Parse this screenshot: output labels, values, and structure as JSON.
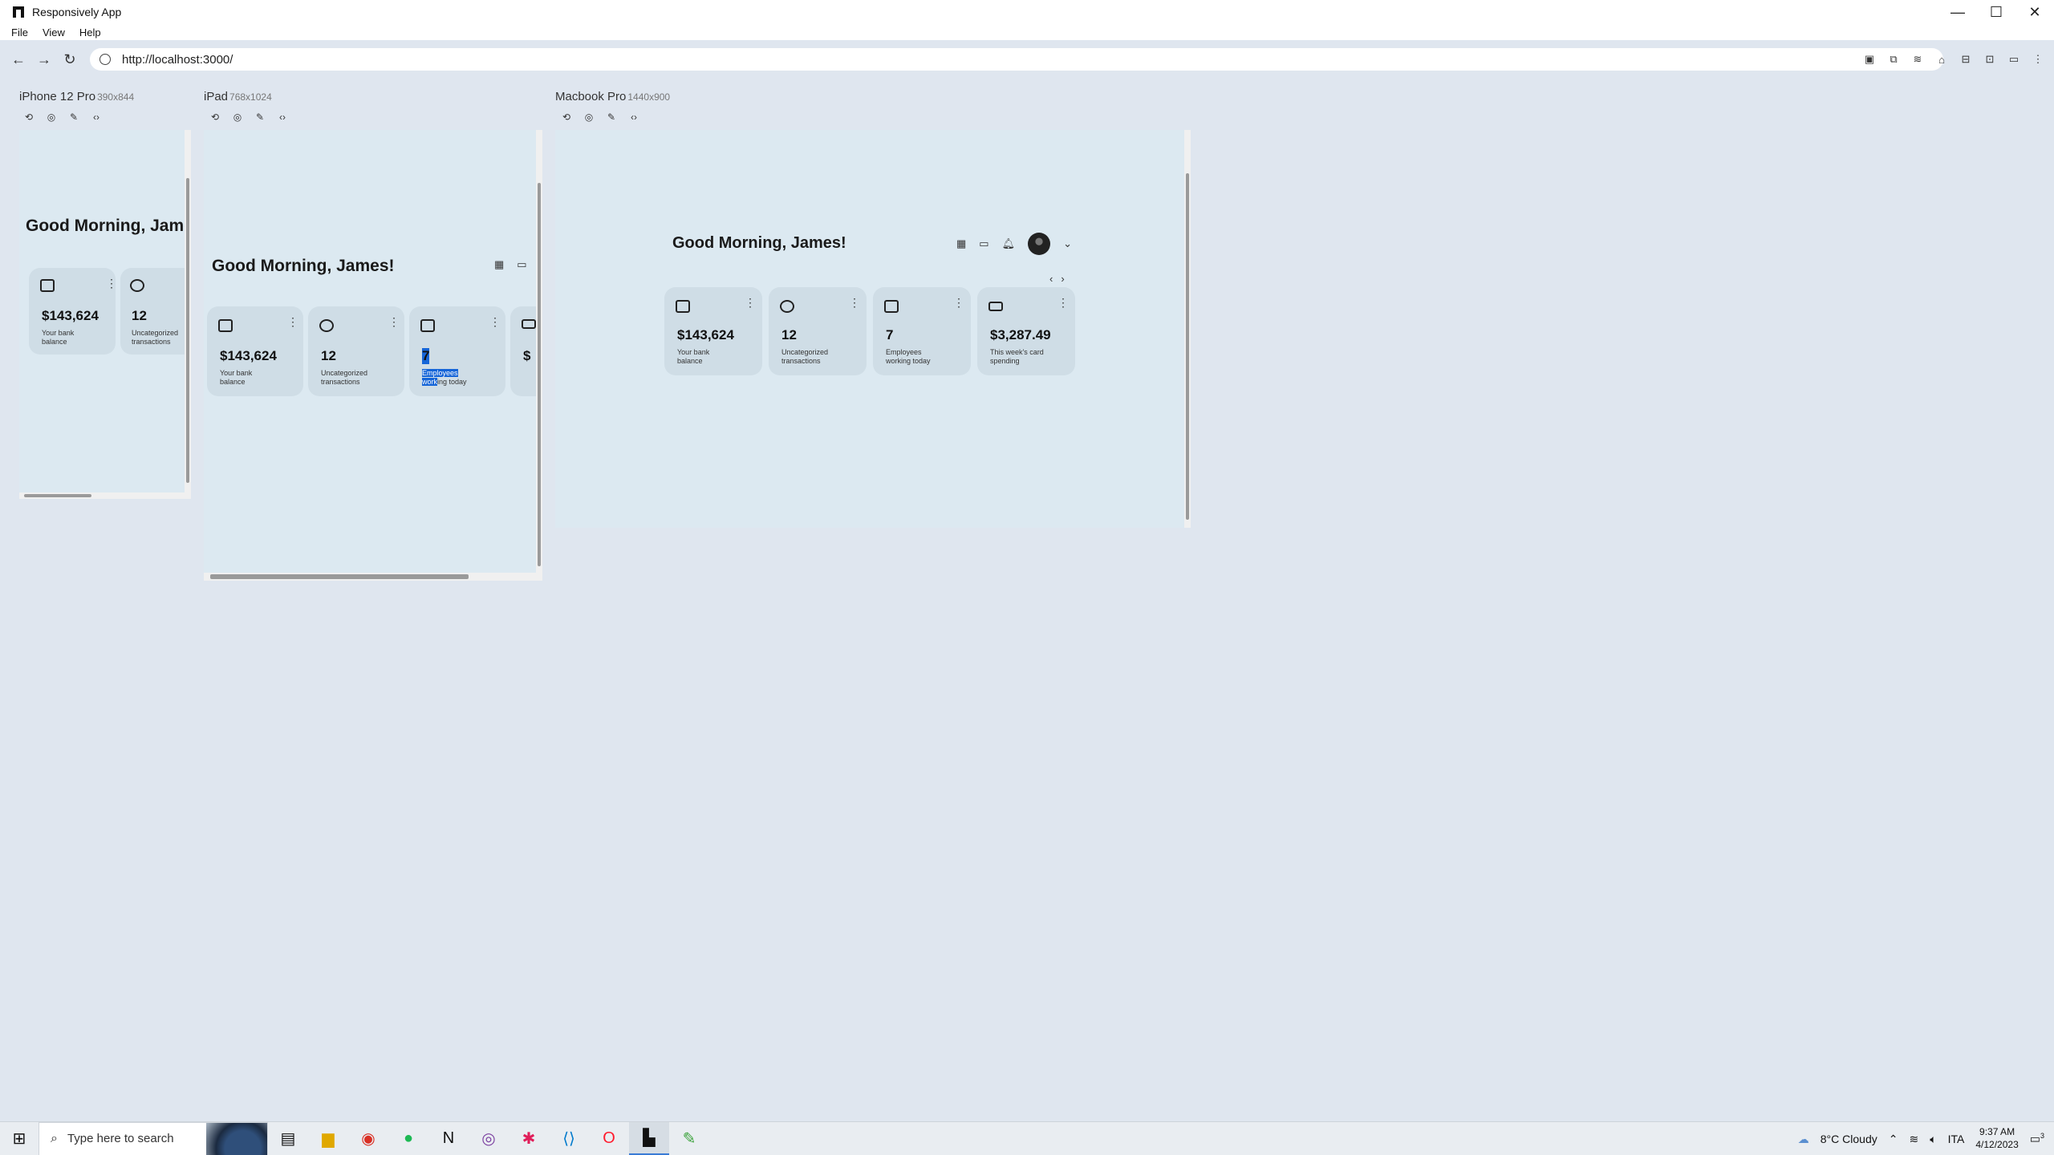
{
  "window": {
    "title": "Responsively App",
    "controls": [
      "—",
      "☐",
      "✕"
    ]
  },
  "menu": [
    "File",
    "View",
    "Help"
  ],
  "address": {
    "url": "http://localhost:3000/"
  },
  "devices": {
    "iphone": {
      "name": "iPhone 12 Pro",
      "size": "390x844"
    },
    "ipad": {
      "name": "iPad",
      "size": "768x1024"
    },
    "macbook": {
      "name": "Macbook Pro",
      "size": "1440x900"
    }
  },
  "dashboard": {
    "greeting_full": "Good Morning, James!",
    "greeting_clipped": "Good Morning, Jame",
    "cards": [
      {
        "value": "$143,624",
        "label": "Your bank balance",
        "icon": "wallet-icon"
      },
      {
        "value": "12",
        "label": "Uncategorized transactions",
        "icon": "pie-chart-icon"
      },
      {
        "value": "7",
        "label": "Employees working today",
        "icon": "calendar-icon"
      },
      {
        "value": "$3,287.49",
        "label": "This week's card spending",
        "icon": "credit-card-icon"
      }
    ],
    "ipad_clipped_value": "$",
    "ipad_highlight_value": "7",
    "ipad_highlight_label_sel": "Employees",
    "ipad_highlight_label_rest1": "work",
    "ipad_highlight_label_rest2": "ing today"
  },
  "taskbar": {
    "search_placeholder": "Type here to search",
    "weather": "8°C  Cloudy",
    "language": "ITA",
    "time": "9:37 AM",
    "date": "4/12/2023",
    "notif_count": "3"
  }
}
